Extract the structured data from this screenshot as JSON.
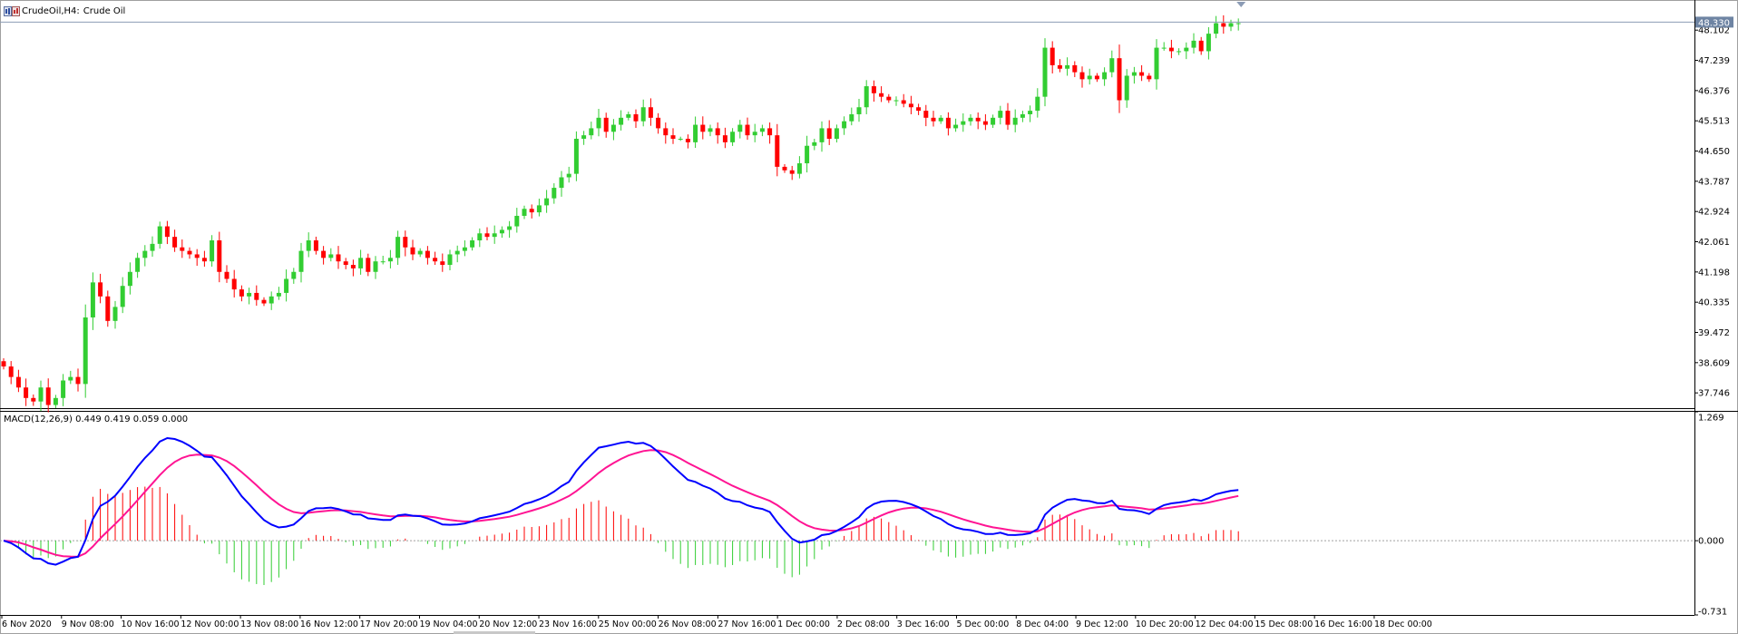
{
  "window": {
    "symbol": "CrudeOil,H4:",
    "description": "Crude Oil"
  },
  "colors": {
    "bull": "#32cd32",
    "bear": "#ff0000",
    "macd_line": "#0000ff",
    "signal_line": "#ff1493",
    "price_marker_bg": "#6e84a3",
    "grid": "#c0c0c0"
  },
  "chart_data": [
    {
      "type": "candlestick",
      "symbol": "CrudeOil",
      "timeframe": "H4",
      "y_ticks": [
        "48.102",
        "47.239",
        "46.376",
        "45.513",
        "44.650",
        "43.787",
        "42.924",
        "42.061",
        "41.198",
        "40.335",
        "39.472",
        "38.609",
        "37.746"
      ],
      "ylim": [
        37.31,
        48.91
      ],
      "current_price": "48.330",
      "x_labels": [
        "6 Nov 2020",
        "9 Nov 08:00",
        "10 Nov 16:00",
        "12 Nov 00:00",
        "13 Nov 08:00",
        "16 Nov 12:00",
        "17 Nov 20:00",
        "19 Nov 04:00",
        "20 Nov 12:00",
        "23 Nov 16:00",
        "25 Nov 00:00",
        "26 Nov 08:00",
        "27 Nov 16:00",
        "1 Dec 00:00",
        "2 Dec 08:00",
        "3 Dec 16:00",
        "5 Dec 00:00",
        "8 Dec 04:00",
        "9 Dec 12:00",
        "10 Dec 20:00",
        "12 Dec 04:00",
        "15 Dec 08:00",
        "16 Dec 16:00",
        "18 Dec 00:00"
      ],
      "close": [
        38.5,
        38.2,
        37.9,
        37.6,
        37.5,
        37.9,
        37.4,
        37.6,
        38.1,
        38.2,
        38.0,
        39.9,
        40.9,
        40.5,
        39.8,
        40.2,
        40.8,
        41.2,
        41.6,
        41.8,
        42.0,
        42.5,
        42.2,
        41.9,
        41.8,
        41.7,
        41.6,
        41.5,
        42.1,
        41.2,
        41.0,
        40.7,
        40.5,
        40.6,
        40.4,
        40.3,
        40.5,
        40.6,
        41.0,
        41.2,
        41.8,
        42.1,
        41.8,
        41.6,
        41.7,
        41.5,
        41.4,
        41.3,
        41.6,
        41.2,
        41.5,
        41.5,
        41.6,
        42.2,
        41.9,
        41.7,
        41.8,
        41.6,
        41.5,
        41.4,
        41.7,
        41.8,
        41.9,
        42.1,
        42.3,
        42.2,
        42.3,
        42.4,
        42.5,
        42.8,
        43.0,
        42.9,
        43.1,
        43.3,
        43.6,
        43.9,
        44.0,
        45.0,
        45.1,
        45.3,
        45.6,
        45.2,
        45.4,
        45.6,
        45.7,
        45.5,
        45.9,
        45.6,
        45.3,
        45.1,
        45.0,
        45.0,
        44.9,
        45.4,
        45.2,
        45.3,
        45.1,
        44.9,
        45.2,
        45.4,
        45.1,
        45.2,
        45.3,
        45.1,
        44.2,
        44.1,
        44.0,
        44.3,
        44.8,
        44.9,
        45.3,
        45.0,
        45.3,
        45.5,
        45.7,
        45.9,
        46.5,
        46.3,
        46.2,
        46.1,
        46.1,
        46.0,
        45.9,
        45.8,
        45.6,
        45.5,
        45.6,
        45.3,
        45.4,
        45.5,
        45.6,
        45.5,
        45.4,
        45.6,
        45.8,
        45.4,
        45.6,
        45.7,
        45.8,
        46.2,
        47.6,
        47.1,
        47.0,
        47.1,
        46.9,
        46.7,
        46.8,
        46.7,
        46.9,
        47.3,
        46.1,
        46.8,
        46.9,
        46.8,
        46.7,
        47.6,
        47.6,
        47.5,
        47.5,
        47.6,
        47.8,
        47.5,
        48.0,
        48.3,
        48.2,
        48.3,
        48.3
      ]
    },
    {
      "type": "macd",
      "label": "MACD(12,26,9) 0.449 0.419 0.059 0.000",
      "params": [
        12,
        26,
        9
      ],
      "macd_value": 0.449,
      "signal_value": 0.419,
      "y_ticks": [
        "1.269",
        "0.000",
        "-0.731"
      ],
      "ylim": [
        -0.731,
        1.269
      ],
      "zero_line": 0.0
    }
  ]
}
